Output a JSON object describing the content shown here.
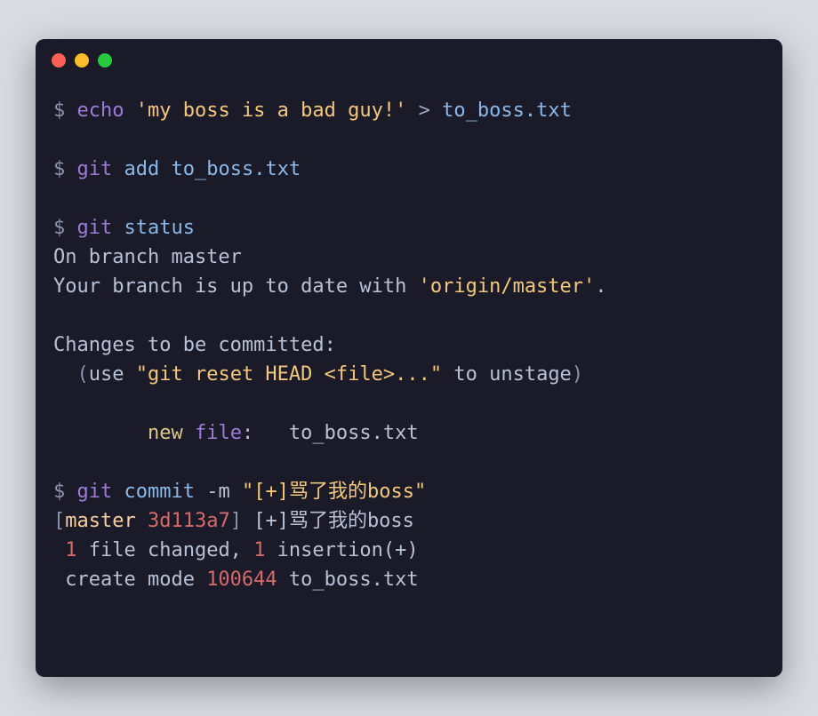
{
  "lines": [
    [
      {
        "cls": "c-prompt",
        "t": "$ "
      },
      {
        "cls": "c-cmd",
        "t": "echo"
      },
      {
        "cls": "c-plain",
        "t": " "
      },
      {
        "cls": "c-str",
        "t": "'my boss is a bad guy!'"
      },
      {
        "cls": "c-plain",
        "t": " "
      },
      {
        "cls": "c-redir",
        "t": ">"
      },
      {
        "cls": "c-plain",
        "t": " "
      },
      {
        "cls": "c-arg",
        "t": "to_boss.txt"
      }
    ],
    [],
    [
      {
        "cls": "c-prompt",
        "t": "$ "
      },
      {
        "cls": "c-cmd",
        "t": "git"
      },
      {
        "cls": "c-plain",
        "t": " "
      },
      {
        "cls": "c-arg",
        "t": "add"
      },
      {
        "cls": "c-plain",
        "t": " "
      },
      {
        "cls": "c-arg",
        "t": "to_boss.txt"
      }
    ],
    [],
    [
      {
        "cls": "c-prompt",
        "t": "$ "
      },
      {
        "cls": "c-cmd",
        "t": "git"
      },
      {
        "cls": "c-plain",
        "t": " "
      },
      {
        "cls": "c-arg",
        "t": "status"
      }
    ],
    [
      {
        "cls": "c-plain",
        "t": "On branch master"
      }
    ],
    [
      {
        "cls": "c-plain",
        "t": "Your branch is up to date with "
      },
      {
        "cls": "c-str",
        "t": "'origin/master'"
      },
      {
        "cls": "c-plain",
        "t": "."
      }
    ],
    [],
    [
      {
        "cls": "c-plain",
        "t": "Changes to be committed:"
      }
    ],
    [
      {
        "cls": "c-muted",
        "t": "  ("
      },
      {
        "cls": "c-plain",
        "t": "use "
      },
      {
        "cls": "c-str",
        "t": "\"git reset HEAD <file>...\""
      },
      {
        "cls": "c-plain",
        "t": " to unstage"
      },
      {
        "cls": "c-muted",
        "t": ")"
      }
    ],
    [],
    [
      {
        "cls": "c-plain",
        "t": "\t"
      },
      {
        "cls": "c-kw-new",
        "t": "new"
      },
      {
        "cls": "c-plain",
        "t": " "
      },
      {
        "cls": "c-kw-file",
        "t": "file"
      },
      {
        "cls": "c-plain",
        "t": ":   to_boss.txt"
      }
    ],
    [],
    [
      {
        "cls": "c-prompt",
        "t": "$ "
      },
      {
        "cls": "c-cmd",
        "t": "git"
      },
      {
        "cls": "c-plain",
        "t": " "
      },
      {
        "cls": "c-arg",
        "t": "commit"
      },
      {
        "cls": "c-plain",
        "t": " "
      },
      {
        "cls": "c-flag",
        "t": "-m"
      },
      {
        "cls": "c-plain",
        "t": " "
      },
      {
        "cls": "c-str",
        "t": "\"[+]骂了我的boss\""
      }
    ],
    [
      {
        "cls": "c-muted",
        "t": "["
      },
      {
        "cls": "c-branch",
        "t": "master"
      },
      {
        "cls": "c-plain",
        "t": " "
      },
      {
        "cls": "c-hash",
        "t": "3d113a7"
      },
      {
        "cls": "c-muted",
        "t": "]"
      },
      {
        "cls": "c-plain",
        "t": " "
      },
      {
        "cls": "c-msg",
        "t": "[+]骂了我的boss"
      }
    ],
    [
      {
        "cls": "c-plain",
        "t": " "
      },
      {
        "cls": "c-num",
        "t": "1"
      },
      {
        "cls": "c-plain",
        "t": " file changed, "
      },
      {
        "cls": "c-num",
        "t": "1"
      },
      {
        "cls": "c-plain",
        "t": " insertion(+)"
      }
    ],
    [
      {
        "cls": "c-plain",
        "t": " create mode "
      },
      {
        "cls": "c-num",
        "t": "100644"
      },
      {
        "cls": "c-plain",
        "t": " to_boss.txt"
      }
    ]
  ]
}
